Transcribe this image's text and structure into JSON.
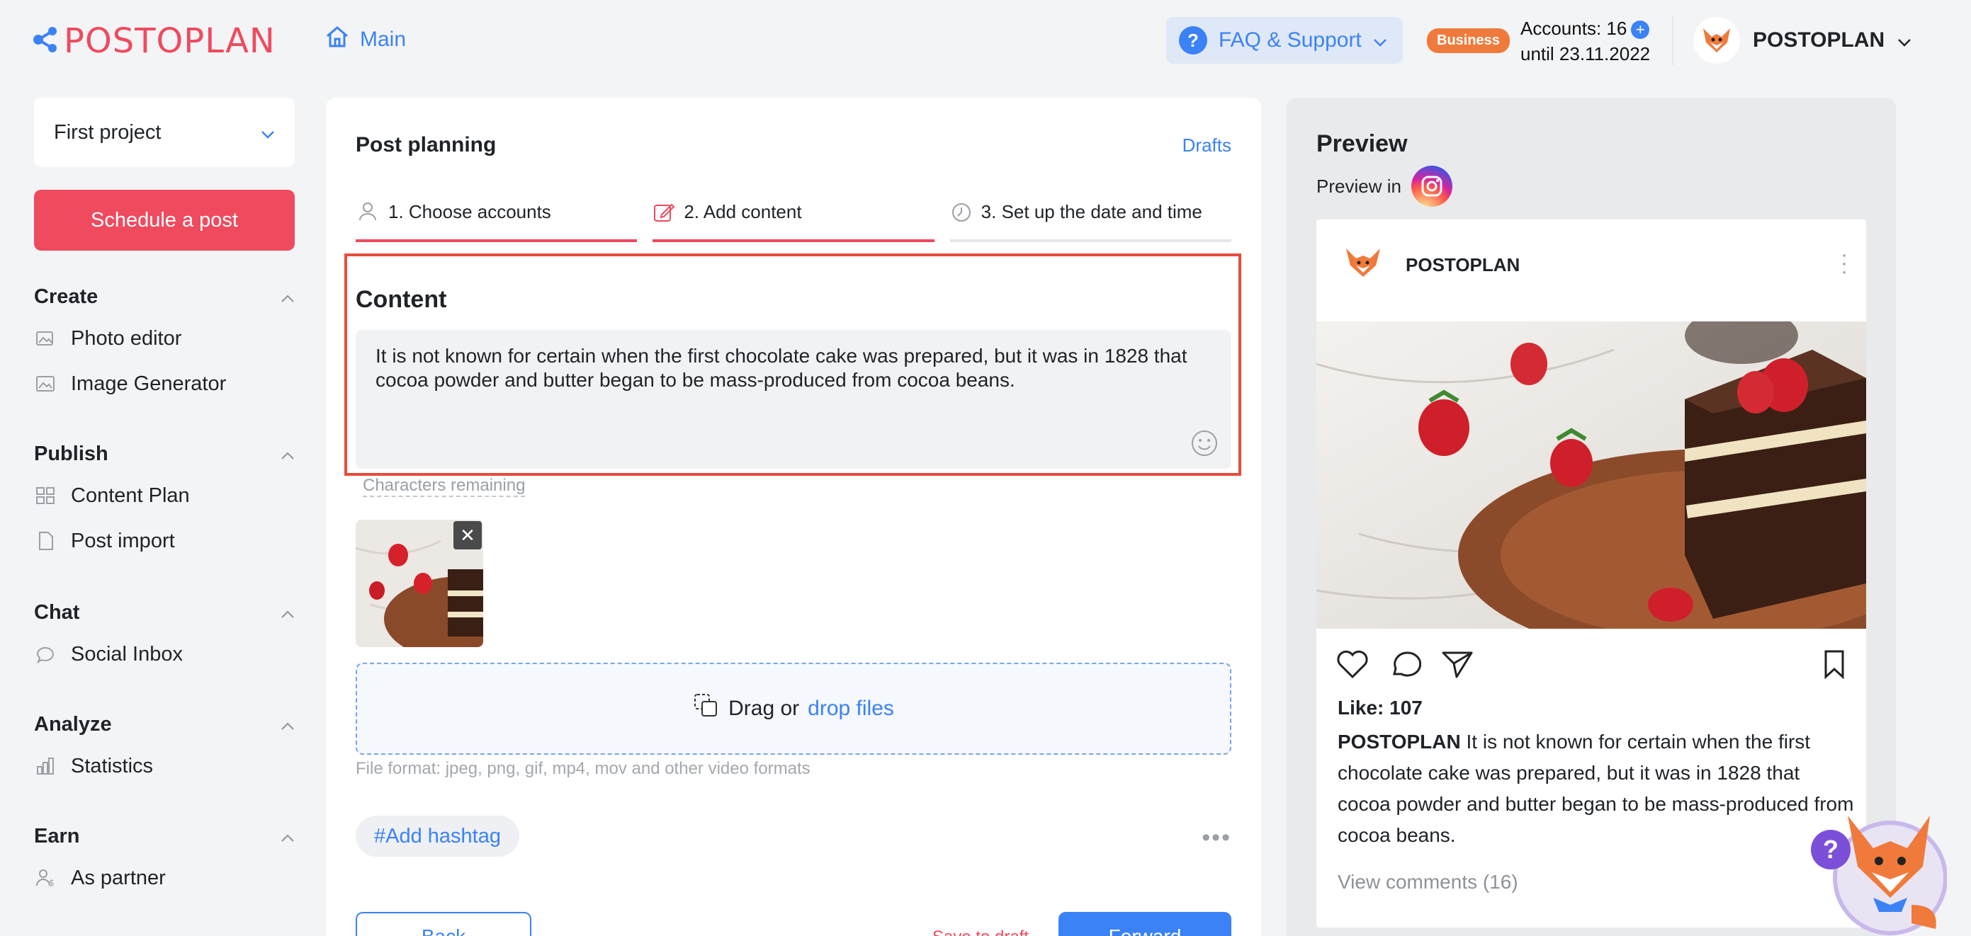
{
  "header": {
    "logo_text": "POSTOPLAN",
    "main_link": "Main",
    "faq_label": "FAQ & Support",
    "plan_badge": "Business",
    "accounts_label": "Accounts: 16",
    "accounts_until": "until 23.11.2022",
    "user_name": "POSTOPLAN"
  },
  "sidebar": {
    "project": "First project",
    "schedule_button": "Schedule a post",
    "sections": [
      {
        "title": "Create",
        "items": [
          "Photo editor",
          "Image Generator"
        ]
      },
      {
        "title": "Publish",
        "items": [
          "Content Plan",
          "Post import"
        ]
      },
      {
        "title": "Chat",
        "items": [
          "Social Inbox"
        ]
      },
      {
        "title": "Analyze",
        "items": [
          "Statistics"
        ]
      },
      {
        "title": "Earn",
        "items": [
          "As partner"
        ]
      }
    ]
  },
  "planning": {
    "title": "Post planning",
    "drafts_link": "Drafts",
    "steps": [
      "1. Choose accounts",
      "2. Add content",
      "3. Set up the date and time"
    ],
    "content_title": "Content",
    "content_text": "It is not known for certain when the first chocolate cake was prepared, but it was in 1828 that cocoa powder and butter began to be mass-produced from cocoa beans.",
    "chars_remaining": "Characters remaining",
    "dropzone_text": "Drag or",
    "dropzone_link": "drop files",
    "file_format": "File format: jpeg, png, gif, mp4, mov and other video formats",
    "hashtag_button": "#Add hashtag",
    "back_button": "Back",
    "save_draft": "Save to draft",
    "forward_button": "Forward"
  },
  "preview": {
    "title": "Preview",
    "preview_in": "Preview in",
    "account_name": "POSTOPLAN",
    "likes": "Like: 107",
    "caption_user": "POSTOPLAN",
    "caption_text": "It is not known for certain when the first chocolate cake was prepared, but it was in 1828 that cocoa powder and butter began to be mass-produced from cocoa beans.",
    "view_comments": "View comments (16)"
  },
  "colors": {
    "brand": "#ef4a5e",
    "accent": "#3b82f6",
    "highlight_border": "#e74c3c"
  }
}
